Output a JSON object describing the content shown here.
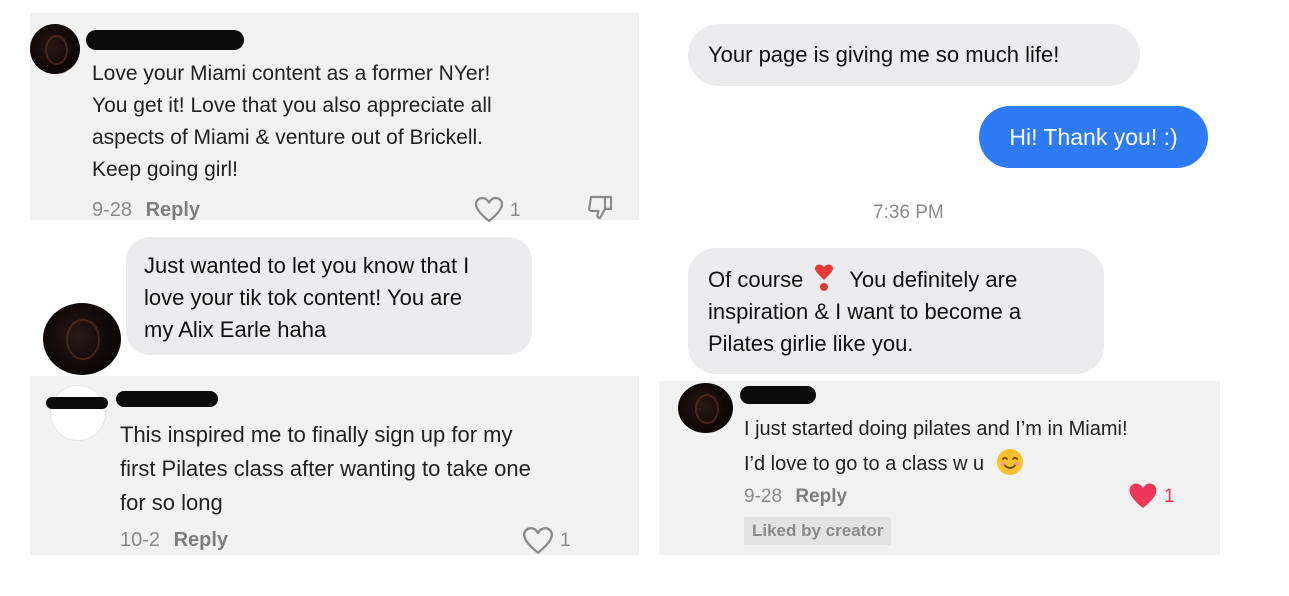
{
  "top_left_comment": {
    "lines": [
      "Love your Miami content as a former NYer!",
      "You get it! Love that you also appreciate all",
      "aspects of Miami & venture out of Brickell.",
      "Keep going girl!"
    ],
    "date": "9-28",
    "reply_label": "Reply",
    "like_count": "1"
  },
  "dm_bubble_left": {
    "lines": [
      "Just wanted to let you know that I",
      "love your tik tok content! You are",
      "my Alix Earle haha"
    ]
  },
  "bottom_left_comment": {
    "lines": [
      "This inspired me to finally sign up for my",
      "first Pilates class after wanting to take one",
      "for so long"
    ],
    "date": "10-2",
    "reply_label": "Reply",
    "like_count": "1"
  },
  "chat_right": {
    "incoming_1": "Your page is giving me so much life!",
    "outgoing_1": "Hi! Thank you! :)",
    "timestamp": "7:36 PM",
    "incoming_2": {
      "line1_prefix": "Of course",
      "line1_suffix": "You definitely are",
      "line2": "inspiration & I want to become a",
      "line3": "Pilates girlie like you."
    }
  },
  "bottom_right_comment": {
    "line1": "I just started doing pilates and I’m in Miami!",
    "line2": "I’d love to go to a class w u",
    "date": "9-28",
    "reply_label": "Reply",
    "like_count": "1",
    "liked_by_creator": "Liked by creator"
  },
  "colors": {
    "blue_bubble": "#2f7bf5",
    "liked_heart": "#f0365a",
    "panel_bg": "#f1f1f1"
  },
  "icons": [
    "heart-outline-icon",
    "dislike-icon",
    "heart-filled-icon",
    "exclamation-heart-icon",
    "smile-emoji-icon"
  ]
}
